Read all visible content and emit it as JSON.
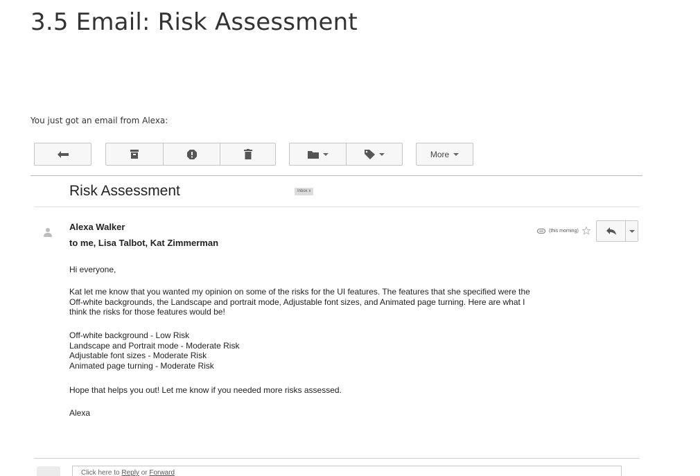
{
  "page": {
    "title": "3.5 Email: Risk Assessment",
    "intro": "You just got an email from Alexa:"
  },
  "toolbar": {
    "back_icon": "back-arrow-icon",
    "group1": [
      "archive-icon",
      "report-spam-icon",
      "delete-icon"
    ],
    "group2": [
      "folder-move-icon",
      "label-tag-icon"
    ],
    "more_label": "More"
  },
  "email": {
    "subject": "Risk Assessment",
    "label_badge": "Inbox x",
    "sender": "Alexa Walker",
    "recipients": "to me, Lisa Talbot, Kat Zimmerman",
    "time": "(this morning)",
    "greeting": "Hi everyone,",
    "paragraph_lines": [
      "Kat let me know that you wanted my opinion on some of the risks for the UI features. The features that she specified were the",
      "Off-white backgrounds, the Landscape and portrait mode, Adjustable font sizes, and Animated page turning. Here are what I",
      "think the risks for those features would be!"
    ],
    "risks": [
      "Off-white background - Low Risk",
      "Landscape and Portrait mode - Moderate Risk",
      "Adjustable font sizes - Moderate Risk",
      "Animated page turning - Moderate Risk"
    ],
    "closing": "Hope that helps you out! Let me know if you needed more risks assessed.",
    "signature": "Alexa"
  },
  "reply_bar": {
    "prefix": "Click here to ",
    "reply_link": "Reply",
    "middle": " or ",
    "forward_link": "Forward"
  },
  "colors": {
    "border": "#c6c6c6",
    "button_bg": "#f7f7f7",
    "icon": "#555555"
  }
}
